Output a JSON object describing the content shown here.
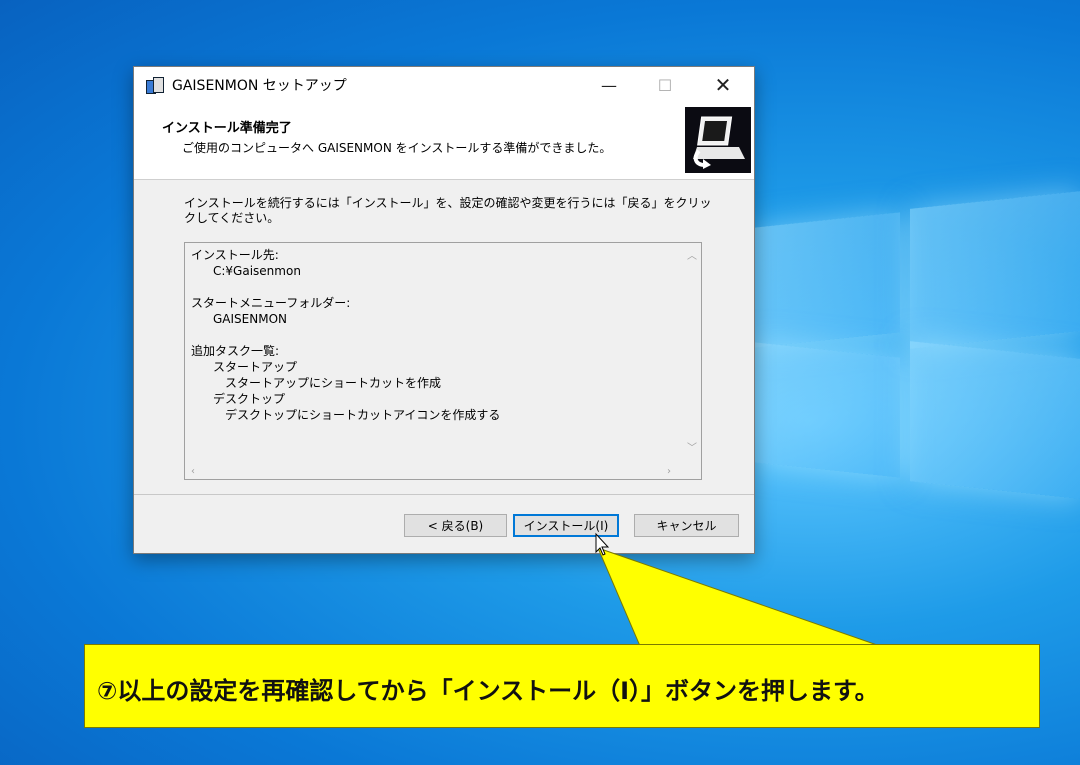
{
  "window": {
    "title": "GAISENMON セットアップ",
    "controls": {
      "minimize": "—",
      "maximize": "☐",
      "close": "✕"
    }
  },
  "header": {
    "title": "インストール準備完了",
    "subtitle": "ご使用のコンピュータへ GAISENMON をインストールする準備ができました。"
  },
  "body": {
    "description_line1": "インストールを続行するには「インストール」を、設定の確認や変更を行うには「戻る」をクリッ",
    "description_line2": "クしてください。",
    "memo": {
      "install_dir_label": "インストール先:",
      "install_dir_value": "C:¥Gaisenmon",
      "start_menu_label": "スタートメニューフォルダー:",
      "start_menu_value": "GAISENMON",
      "tasks_label": "追加タスク一覧:",
      "task1_group": "スタートアップ",
      "task1_item": "スタートアップにショートカットを作成",
      "task2_group": "デスクトップ",
      "task2_item": "デスクトップにショートカットアイコンを作成する"
    }
  },
  "buttons": {
    "back": "< 戻る(B)",
    "install": "インストール(I)",
    "cancel": "キャンセル"
  },
  "callout": {
    "text": "⑦以上の設定を再確認してから「インストール（I）」ボタンを押します。"
  },
  "colors": {
    "callout": "#ffff00",
    "desktop": "#0a78d6",
    "accent": "#0078d7"
  }
}
